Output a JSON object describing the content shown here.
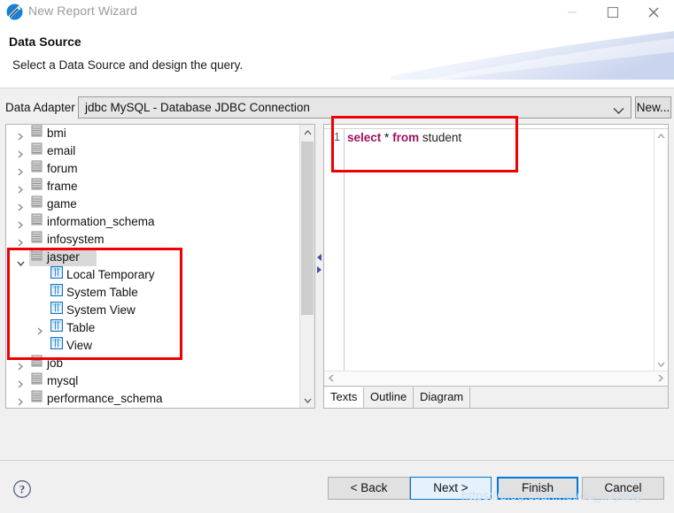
{
  "window": {
    "title": "New Report Wizard",
    "app_icon": "jasperreports-icon",
    "controls": {
      "minimize": "minimize-icon",
      "maximize": "maximize-icon",
      "close": "close-icon"
    }
  },
  "header": {
    "title": "Data Source",
    "subtitle": "Select a Data Source and design the query."
  },
  "adapter": {
    "label": "Data Adapter",
    "value": "jdbc MySQL - Database JDBC Connection",
    "dropdown_icon": "chevron-down-icon",
    "new_button": "New..."
  },
  "tree": {
    "nodes": [
      {
        "label": "bmi",
        "level": 1,
        "icon": "database-icon",
        "twisty": "collapsed",
        "selected": false
      },
      {
        "label": "email",
        "level": 1,
        "icon": "database-icon",
        "twisty": "collapsed",
        "selected": false
      },
      {
        "label": "forum",
        "level": 1,
        "icon": "database-icon",
        "twisty": "collapsed",
        "selected": false
      },
      {
        "label": "frame",
        "level": 1,
        "icon": "database-icon",
        "twisty": "collapsed",
        "selected": false
      },
      {
        "label": "game",
        "level": 1,
        "icon": "database-icon",
        "twisty": "collapsed",
        "selected": false
      },
      {
        "label": "information_schema",
        "level": 1,
        "icon": "database-icon",
        "twisty": "collapsed",
        "selected": false
      },
      {
        "label": "infosystem",
        "level": 1,
        "icon": "database-icon",
        "twisty": "collapsed",
        "selected": false
      },
      {
        "label": "jasper",
        "level": 1,
        "icon": "database-icon",
        "twisty": "expanded",
        "selected": true
      },
      {
        "label": "Local Temporary",
        "level": 2,
        "icon": "table-icon",
        "twisty": "none",
        "selected": false
      },
      {
        "label": "System Table",
        "level": 2,
        "icon": "table-icon",
        "twisty": "none",
        "selected": false
      },
      {
        "label": "System View",
        "level": 2,
        "icon": "table-icon",
        "twisty": "none",
        "selected": false
      },
      {
        "label": "Table",
        "level": 2,
        "icon": "table-icon",
        "twisty": "collapsed",
        "selected": false
      },
      {
        "label": "View",
        "level": 2,
        "icon": "table-icon",
        "twisty": "none",
        "selected": false
      },
      {
        "label": "job",
        "level": 1,
        "icon": "database-icon",
        "twisty": "collapsed",
        "selected": false
      },
      {
        "label": "mysql",
        "level": 1,
        "icon": "database-icon",
        "twisty": "collapsed",
        "selected": false
      },
      {
        "label": "performance_schema",
        "level": 1,
        "icon": "database-icon",
        "twisty": "collapsed",
        "selected": false
      }
    ],
    "scrollbar": {
      "up_icon": "chevron-up-icon",
      "down_icon": "chevron-down-icon"
    }
  },
  "splitter": {
    "collapse_left_icon": "triangle-left-icon",
    "collapse_right_icon": "triangle-right-icon"
  },
  "sql": {
    "line_number": "1",
    "tokens": [
      {
        "text": "select",
        "type": "keyword"
      },
      {
        "text": " ",
        "type": "plain"
      },
      {
        "text": "*",
        "type": "operator"
      },
      {
        "text": " ",
        "type": "plain"
      },
      {
        "text": "from",
        "type": "keyword"
      },
      {
        "text": " ",
        "type": "plain"
      },
      {
        "text": "student",
        "type": "identifier"
      }
    ],
    "plain_text": "select * from student",
    "tabs": [
      {
        "label": "Texts",
        "active": true
      },
      {
        "label": "Outline",
        "active": false
      },
      {
        "label": "Diagram",
        "active": false
      }
    ],
    "scroll_left_icon": "chevron-left-icon",
    "scroll_right_icon": "chevron-right-icon"
  },
  "footer": {
    "help_icon": "help-circle-icon",
    "buttons": [
      {
        "id": "back",
        "label": "< Back",
        "state": "normal"
      },
      {
        "id": "next",
        "label": "Next >",
        "state": "hover"
      },
      {
        "id": "finish",
        "label": "Finish",
        "state": "default"
      },
      {
        "id": "cancel",
        "label": "Cancel",
        "state": "normal"
      }
    ]
  },
  "watermark": {
    "text": "https://blog.csdn.net/du_liuyang"
  },
  "annotations": {
    "tree_box": "red-highlight-rectangle",
    "sql_box": "red-highlight-rectangle",
    "color": "#ec0000"
  },
  "colors": {
    "accent": "#0078d7",
    "keyword": "#a01060",
    "annotation": "#ec0000",
    "window_bg": "#f0f0f0"
  }
}
